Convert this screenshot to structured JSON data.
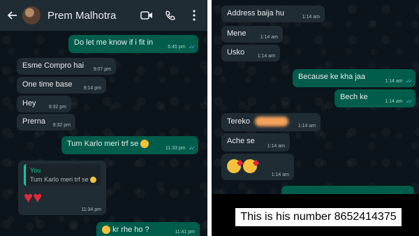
{
  "left_panel": {
    "header": {
      "contact_name": "Prem Malhotra"
    },
    "messages": [
      {
        "dir": "out",
        "text": "Do let me know if i fit in",
        "time": "6:45 pm"
      },
      {
        "dir": "in",
        "text": "Esme Compro hai",
        "time": "9:07 pm"
      },
      {
        "dir": "in",
        "text": "One time base",
        "time": "9:14 pm"
      },
      {
        "dir": "in",
        "text": "Hey",
        "time": "9:32 pm"
      },
      {
        "dir": "in",
        "text": "Prerna",
        "time": "9:32 pm"
      },
      {
        "dir": "out",
        "text": "Tum Karlo meri trf se",
        "time": "11:33 pm"
      },
      {
        "dir": "in",
        "quote_author": "You",
        "quote_text": "Tum Karlo meri trf se",
        "time": "11:34 pm"
      },
      {
        "dir": "out",
        "text": "kr rhe ho ?",
        "time": "11:41 pm"
      }
    ]
  },
  "right_panel": {
    "messages": [
      {
        "dir": "in",
        "text": "Address baija hu",
        "time": "1:14 am"
      },
      {
        "dir": "in",
        "text": "Mene",
        "time": "1:14 am"
      },
      {
        "dir": "in",
        "text": "Usko",
        "time": "1:14 am"
      },
      {
        "dir": "out",
        "text": "Because ke kha jaa",
        "time": "1:14 am"
      },
      {
        "dir": "out",
        "text": "Bech ke",
        "time": "1:14 am"
      },
      {
        "dir": "in",
        "text": "Tereko",
        "time": "1:14 am"
      },
      {
        "dir": "in",
        "text": "Ache se",
        "time": "1:14 am"
      },
      {
        "dir": "in",
        "time": "1:14 am"
      }
    ],
    "caption": "This is his number  8652414375"
  },
  "colors": {
    "chat_bg": "#0b141a",
    "header_bg": "#1f2c34",
    "incoming_bubble": "#202c33",
    "outgoing_bubble": "#005c4b",
    "read_ticks": "#53bdeb"
  }
}
